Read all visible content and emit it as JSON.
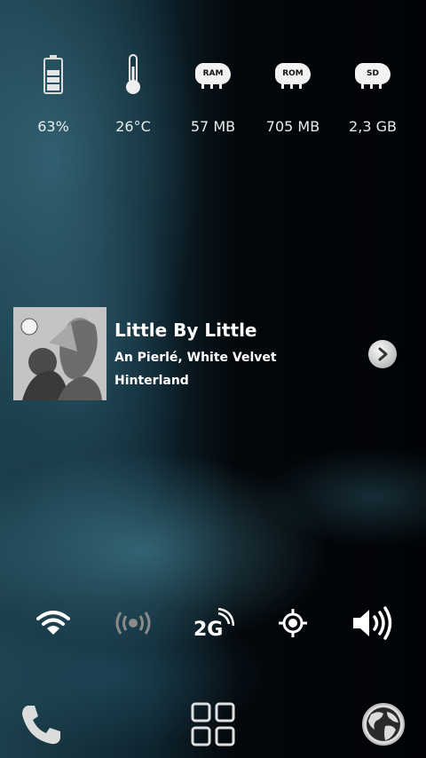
{
  "status_widgets": [
    {
      "name": "battery",
      "icon": "battery-icon",
      "value": "63%",
      "level": 0.63
    },
    {
      "name": "temperature",
      "icon": "thermometer-icon",
      "value": "26°C"
    },
    {
      "name": "ram",
      "icon": "ram-chip-icon",
      "chip_label": "RAM",
      "value": "57 MB"
    },
    {
      "name": "rom",
      "icon": "rom-chip-icon",
      "chip_label": "ROM",
      "value": "705 MB"
    },
    {
      "name": "sd",
      "icon": "sd-chip-icon",
      "chip_label": "SD",
      "value": "2,3 GB"
    }
  ],
  "music": {
    "title": "Little By Little",
    "artist": "An Pierlé, White Velvet",
    "album": "Hinterland"
  },
  "toggles": [
    {
      "name": "wifi",
      "icon": "wifi-icon",
      "state": "on"
    },
    {
      "name": "nfc",
      "icon": "wireless-broadcast-icon",
      "state": "off"
    },
    {
      "name": "mobile-data",
      "icon": "2g-icon",
      "label": "2G",
      "state": "on"
    },
    {
      "name": "gps",
      "icon": "gps-icon",
      "state": "on"
    },
    {
      "name": "sound",
      "icon": "speaker-icon",
      "state": "on"
    }
  ],
  "dock": [
    {
      "name": "phone",
      "icon": "phone-icon"
    },
    {
      "name": "app-drawer",
      "icon": "app-grid-icon"
    },
    {
      "name": "browser",
      "icon": "globe-icon"
    }
  ],
  "colors": {
    "accent_off": "#8a8a8a",
    "icon_on": "#ffffff"
  }
}
